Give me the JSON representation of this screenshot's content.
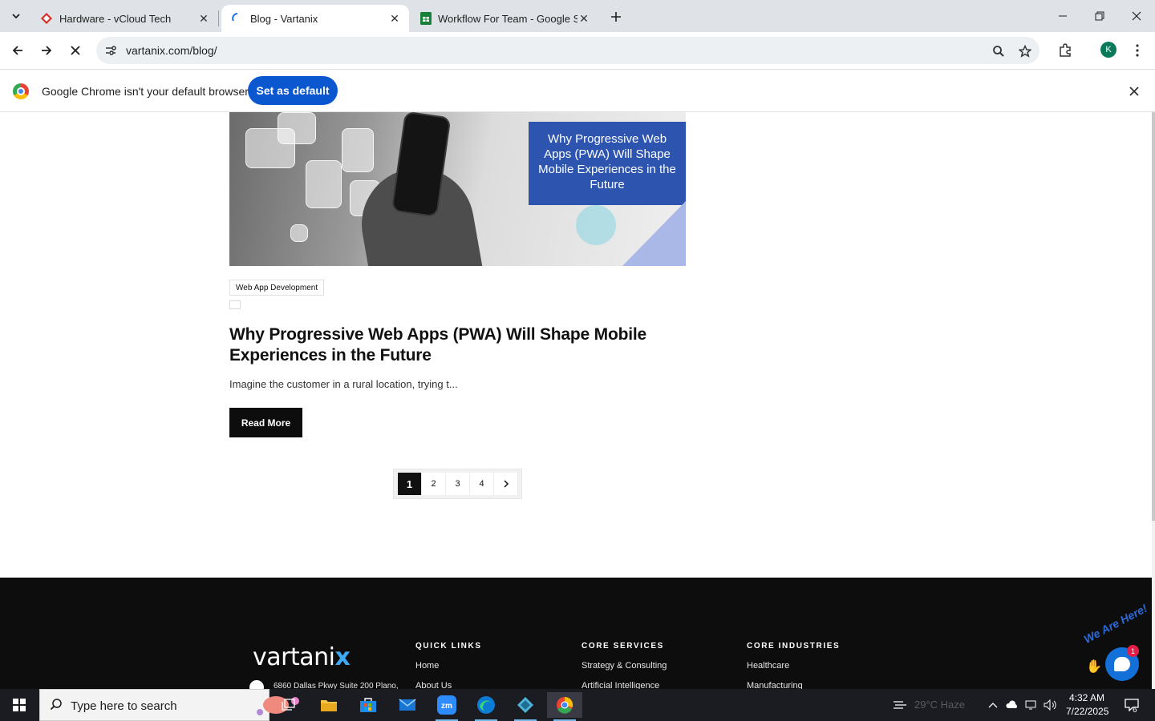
{
  "browser": {
    "tabs": [
      {
        "title": "Hardware - vCloud Tech",
        "active": false
      },
      {
        "title": "Blog - Vartanix",
        "active": true
      },
      {
        "title": "Workflow For Team - Google Sh",
        "active": false
      }
    ],
    "url": "vartanix.com/blog/",
    "profile_initial": "K",
    "infobar": {
      "message": "Google Chrome isn't your default browser",
      "button": "Set as default"
    }
  },
  "post": {
    "hero_text": "Why Progressive Web Apps (PWA) Will Shape Mobile Experiences in the Future",
    "category": "Web App Development",
    "title": "Why Progressive Web Apps (PWA) Will Shape Mobile Experiences in the Future",
    "excerpt": "Imagine the customer in a rural location, trying t...",
    "read_more": "Read More"
  },
  "pagination": {
    "pages": [
      "1",
      "2",
      "3",
      "4"
    ],
    "current": "1",
    "next_icon": "chevron-right-icon"
  },
  "footer": {
    "logo_text": "vartani",
    "logo_accent": "x",
    "address": "6860 Dallas Pkwy Suite 200 Plano,",
    "columns": [
      {
        "heading": "QUICK LINKS",
        "links": [
          "Home",
          "About Us"
        ]
      },
      {
        "heading": "CORE SERVICES",
        "links": [
          "Strategy & Consulting",
          "Artificial Intelligence"
        ]
      },
      {
        "heading": "CORE INDUSTRIES",
        "links": [
          "Healthcare",
          "Manufacturing"
        ]
      }
    ]
  },
  "chat_widget": {
    "label": "We Are Here!",
    "badge": "1"
  },
  "taskbar": {
    "search_placeholder": "Type here to search",
    "weather": "29°C  Haze",
    "time": "4:32 AM",
    "date": "7/22/2025",
    "notification_count": "6"
  },
  "colors": {
    "accent_blue": "#0b57d0",
    "hero_blue": "#2d55b0",
    "footer_bg": "#0d0d0d",
    "logo_x": "#3fa9f5"
  }
}
